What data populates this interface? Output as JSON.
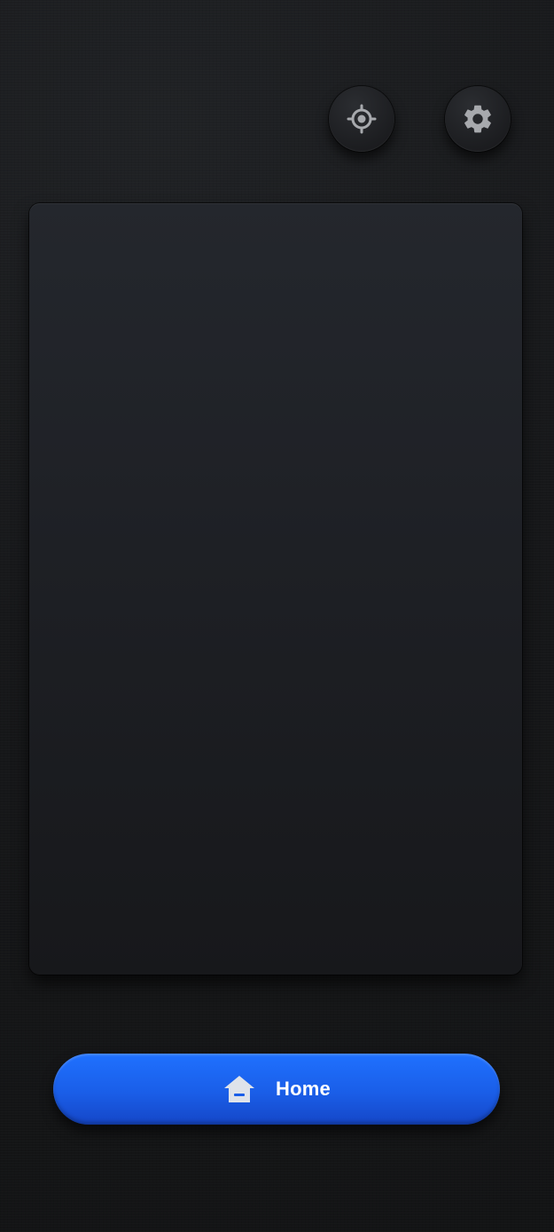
{
  "toolbar": {
    "locate_icon": "crosshair-icon",
    "settings_icon": "gear-icon"
  },
  "bottom_button": {
    "label": "Home",
    "icon": "home-icon"
  },
  "colors": {
    "accent": "#1a5ee8",
    "icon_gray": "#a7a9ad",
    "background": "#17181a"
  }
}
